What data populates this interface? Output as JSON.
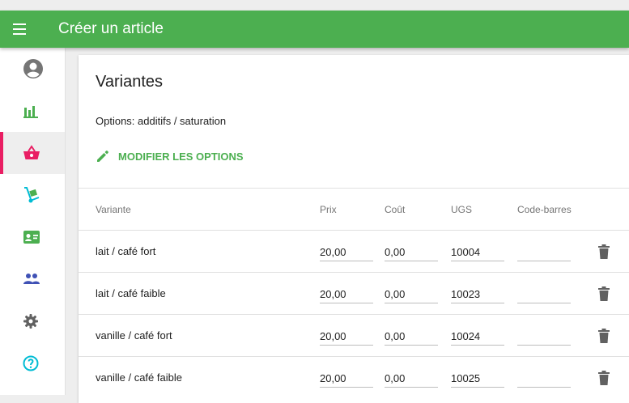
{
  "appbar": {
    "title": "Créer un article"
  },
  "sidebar": {
    "items": [
      {
        "icon": "account-circle-icon",
        "name": "sidebar-item-account"
      },
      {
        "icon": "bar-chart-icon",
        "name": "sidebar-item-reports"
      },
      {
        "icon": "basket-icon",
        "name": "sidebar-item-items",
        "active": true
      },
      {
        "icon": "dolly-icon",
        "name": "sidebar-item-inventory"
      },
      {
        "icon": "badge-icon",
        "name": "sidebar-item-employees"
      },
      {
        "icon": "people-icon",
        "name": "sidebar-item-customers"
      },
      {
        "icon": "gear-icon",
        "name": "sidebar-item-settings"
      },
      {
        "icon": "help-icon",
        "name": "sidebar-item-help"
      }
    ]
  },
  "card": {
    "title": "Variantes",
    "options": "Options: additifs / saturation",
    "edit_label": "MODIFIER LES OPTIONS"
  },
  "table": {
    "headers": {
      "variant": "Variante",
      "price": "Prix",
      "cost": "Coût",
      "sku": "UGS",
      "barcode": "Code-barres"
    },
    "rows": [
      {
        "variant": "lait / café fort",
        "price": "20,00",
        "cost": "0,00",
        "sku": "10004",
        "barcode": ""
      },
      {
        "variant": "lait / café faible",
        "price": "20,00",
        "cost": "0,00",
        "sku": "10023",
        "barcode": ""
      },
      {
        "variant": "vanille / café fort",
        "price": "20,00",
        "cost": "0,00",
        "sku": "10024",
        "barcode": ""
      },
      {
        "variant": "vanille / café faible",
        "price": "20,00",
        "cost": "0,00",
        "sku": "10025",
        "barcode": ""
      }
    ]
  },
  "colors": {
    "primary": "#4caf50",
    "active_indicator": "#e91e63",
    "icon_green": "#4caf50",
    "icon_teal": "#00bcd4"
  }
}
